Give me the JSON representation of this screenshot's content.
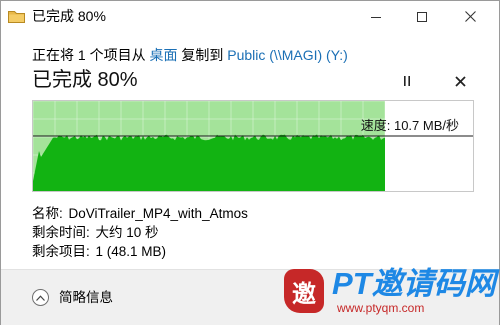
{
  "window": {
    "title": "已完成 80%",
    "app_icon": "folder-copy-icon"
  },
  "dialog": {
    "copy_prefix": "正在将 1 个项目从 ",
    "source": "桌面",
    "copy_middle": " 复制到 ",
    "destination": "Public (\\\\MAGI) (Y:)",
    "progress_title": "已完成 80%",
    "progress_percent": 80,
    "speed_label": "速度: 10.7 MB/秒",
    "name_label": "名称: ",
    "name_value": "DoViTrailer_MP4_with_Atmos",
    "time_label": "剩余时间: ",
    "time_value": "大约 10 秒",
    "items_label": "剩余项目: ",
    "items_value": "1 (48.1 MB)",
    "details_toggle": "简略信息"
  },
  "colors": {
    "graph_fill": "#12b312",
    "graph_done_bg": "#a4e39a",
    "link": "#1a6fb5",
    "footer": "#f0f0f0"
  },
  "watermark": {
    "logo_char": "邀",
    "brand": "PT邀请码网",
    "url": "www.ptyqm.com"
  }
}
